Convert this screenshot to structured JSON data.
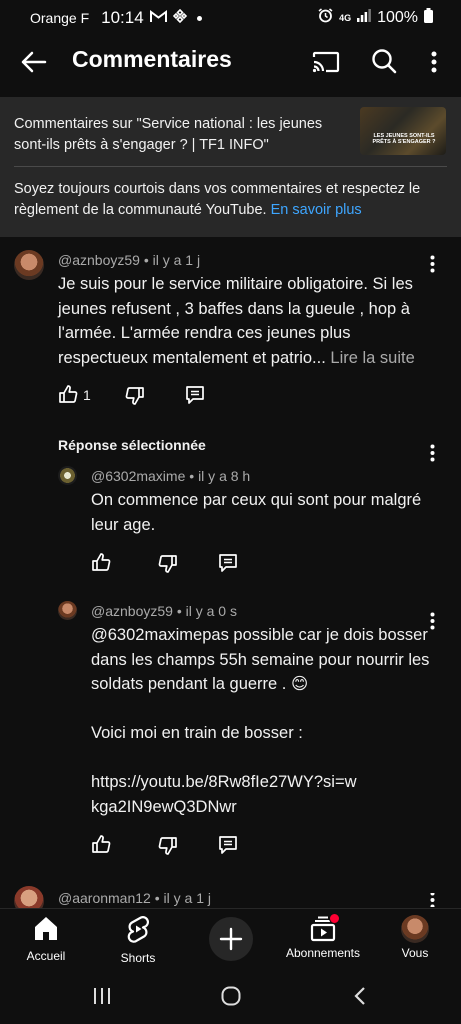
{
  "status_bar": {
    "carrier": "Orange F",
    "time": "10:14",
    "network": "4G",
    "battery": "100%"
  },
  "header": {
    "title": "Commentaires"
  },
  "video": {
    "title": "Commentaires sur \"Service national : les jeunes sont-ils prêts à s'engager ? | TF1 INFO\"",
    "thumbnail_text": "LES JEUNES SONT-ILS PRÊTS À S'ENGAGER ?"
  },
  "guidelines": {
    "text": "Soyez toujours courtois dans vos commentaires et respectez le règlement de la communauté YouTube. ",
    "link": "En savoir plus"
  },
  "comments": [
    {
      "author": "@aznboyz59",
      "time": "il y a 1 j",
      "text": "Je suis pour le service militaire obligatoire.  Si les jeunes refusent , 3 baffes dans la gueule , hop à l'armée.  L'armée rendra ces jeunes plus respectueux mentalement et patrio...",
      "more": "Lire la suite",
      "likes": "1"
    }
  ],
  "selected_reply_heading": "Réponse sélectionnée",
  "replies": [
    {
      "author": "@6302maxime",
      "time": "il y a 8 h",
      "text": "On commence par ceux qui sont pour malgré leur age."
    },
    {
      "author": "@aznboyz59",
      "time": "il y a 0 s",
      "text": "@6302maximepas possible car je dois bosser dans les champs 55h semaine pour nourrir les soldats pendant la guerre  . 😊",
      "text2": "Voici moi en train de bosser :",
      "link": "https://youtu.be/8Rw8fIe27WY?si=wkga2IN9ewQ3DNwr"
    }
  ],
  "next_comment": {
    "author": "@aaronman12",
    "time": "il y a 1 j"
  },
  "bottom_nav": [
    {
      "label": "Accueil",
      "icon": "home-icon"
    },
    {
      "label": "Shorts",
      "icon": "shorts-icon"
    },
    {
      "label": "",
      "icon": "create-icon"
    },
    {
      "label": "Abonnements",
      "icon": "subscriptions-icon"
    },
    {
      "label": "Vous",
      "icon": "avatar"
    }
  ],
  "colors": {
    "background": "#0f0f0f",
    "panel": "#282828",
    "link": "#3ea6ff",
    "muted": "#aaaaaa",
    "notification": "#ff0033"
  }
}
